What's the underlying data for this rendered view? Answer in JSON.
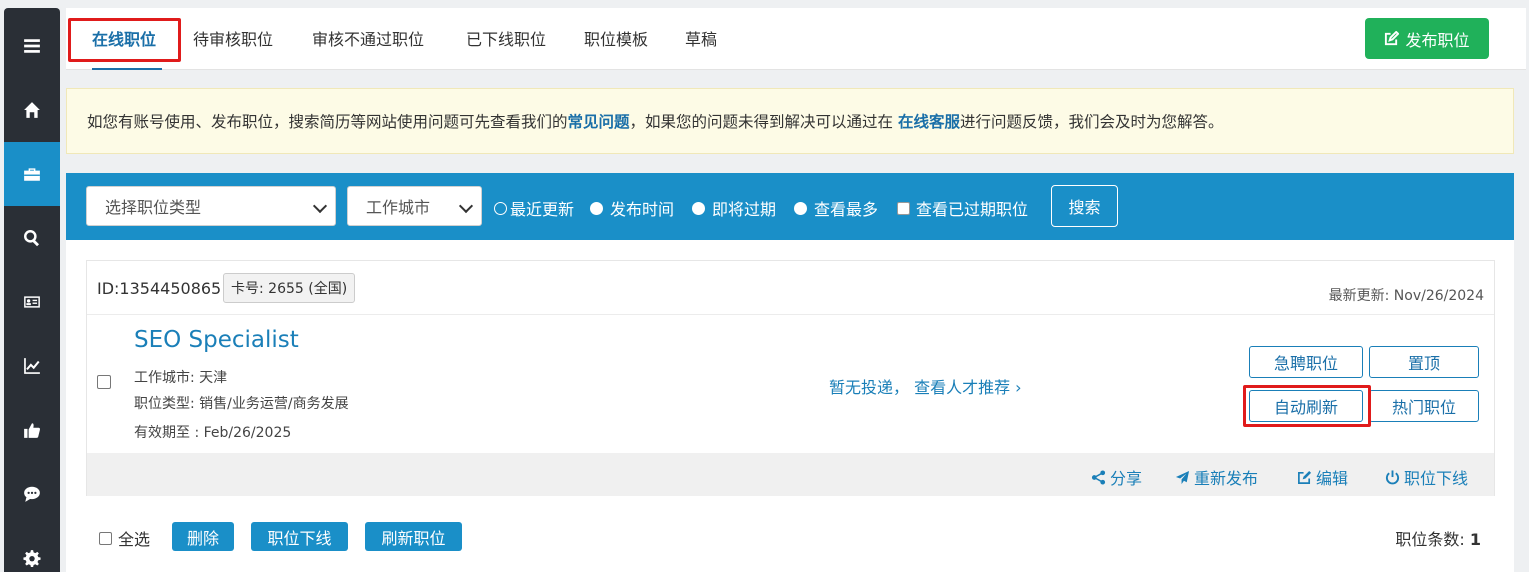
{
  "sidebar": {
    "items": [
      {
        "icon": "menu-icon"
      },
      {
        "icon": "home-icon"
      },
      {
        "icon": "briefcase-icon",
        "active": true
      },
      {
        "icon": "search-icon"
      },
      {
        "icon": "id-card-icon"
      },
      {
        "icon": "line-chart-icon"
      },
      {
        "icon": "thumbs-up-icon"
      },
      {
        "icon": "comment-icon"
      },
      {
        "icon": "gear-icon"
      }
    ]
  },
  "tabs": [
    {
      "label": "在线职位",
      "active": true
    },
    {
      "label": "待审核职位"
    },
    {
      "label": "审核不通过职位"
    },
    {
      "label": "已下线职位"
    },
    {
      "label": "职位模板"
    },
    {
      "label": "草稿"
    }
  ],
  "publish_button": "发布职位",
  "notice": {
    "part1": "如您有账号使用、发布职位，搜索简历等网站使用问题可先查看我们的",
    "link1": "常见问题",
    "part2": "，如果您的问题未得到解决可以通过在 ",
    "link2": "在线客服",
    "part3": "进行问题反馈，我们会及时为您解答。"
  },
  "filter": {
    "job_type_select": "选择职位类型",
    "city_select": "工作城市",
    "sort_options": [
      "最近更新",
      "发布时间",
      "即将过期",
      "查看最多"
    ],
    "selected_sort": "最近更新",
    "show_expired_label": "查看已过期职位",
    "search_button": "搜索"
  },
  "job": {
    "id_text": "ID:1354450865",
    "card_badge": "卡号: 2655 (全国)",
    "updated": "最新更新: Nov/26/2024",
    "title": "SEO Specialist",
    "city": "工作城市: 天津",
    "category": "职位类型: 销售/业务运营/商务发展",
    "expires": "有效期至 : Feb/26/2025",
    "no_apply_text": "暂无投递， 查看人才推荐 ›",
    "actions": {
      "urgent": "急聘职位",
      "top": "置顶",
      "auto_refresh": "自动刷新",
      "hot": "热门职位"
    },
    "footer": {
      "share": "分享",
      "republish": "重新发布",
      "edit": "编辑",
      "offline": "职位下线"
    }
  },
  "bulk": {
    "select_all": "全选",
    "delete": "删除",
    "offline": "职位下线",
    "refresh": "刷新职位",
    "count_label": "职位条数:",
    "count_value": "1"
  },
  "colors": {
    "accent": "#1a8fc8",
    "publish_green": "#20b15a",
    "sidebar": "#2a2f36",
    "highlight_red": "#e01b1b"
  }
}
